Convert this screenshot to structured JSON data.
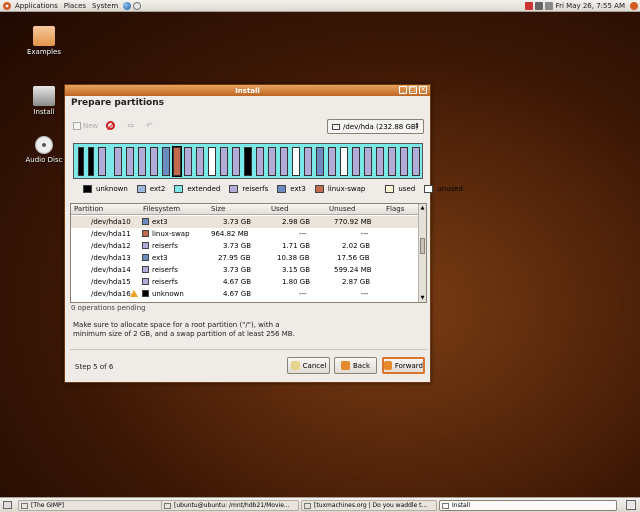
{
  "topbar": {
    "menus": [
      "Applications",
      "Places",
      "System"
    ],
    "clock": "Fri May 26,  7:55 AM"
  },
  "desktop": {
    "icons": [
      {
        "label": "Examples",
        "icon": "folder-icon"
      },
      {
        "label": "Install",
        "icon": "install-icon"
      },
      {
        "label": "Audio Disc",
        "icon": "cd-icon"
      }
    ]
  },
  "window": {
    "title": "Install",
    "heading": "Prepare partitions",
    "toolbar": {
      "new_label": "New"
    },
    "device": "/dev/hda  (232.88 GB)",
    "legend": [
      {
        "label": "unknown",
        "color": "#000000"
      },
      {
        "label": "ext2",
        "color": "#9fb7d8"
      },
      {
        "label": "extended",
        "color": "#7de8e8"
      },
      {
        "label": "reiserfs",
        "color": "#b3acd8"
      },
      {
        "label": "ext3",
        "color": "#6c8cc0"
      },
      {
        "label": "linux-swap",
        "color": "#c26a4f"
      },
      {
        "label": "used",
        "color": "#f6f2d2"
      },
      {
        "label": "unused",
        "color": "#ffffff"
      }
    ],
    "table": {
      "headers": [
        "Partition",
        "Filesystem",
        "Size",
        "Used",
        "Unused",
        "Flags"
      ],
      "rows": [
        {
          "partition": "/dev/hda10",
          "fs": "ext3",
          "size": "3.73 GB",
          "used": "2.98 GB",
          "unused": "770.92 MB",
          "color": "#6c8cc0"
        },
        {
          "partition": "/dev/hda11",
          "fs": "linux-swap",
          "size": "964.82 MB",
          "used": "---",
          "unused": "---",
          "color": "#c26a4f"
        },
        {
          "partition": "/dev/hda12",
          "fs": "reiserfs",
          "size": "3.73 GB",
          "used": "1.71 GB",
          "unused": "2.02 GB",
          "color": "#b3acd8"
        },
        {
          "partition": "/dev/hda13",
          "fs": "ext3",
          "size": "27.95 GB",
          "used": "10.38 GB",
          "unused": "17.56 GB",
          "color": "#6c8cc0"
        },
        {
          "partition": "/dev/hda14",
          "fs": "reiserfs",
          "size": "3.73 GB",
          "used": "3.15 GB",
          "unused": "599.24 MB",
          "color": "#b3acd8"
        },
        {
          "partition": "/dev/hda15",
          "fs": "reiserfs",
          "size": "4.67 GB",
          "used": "1.80 GB",
          "unused": "2.87 GB",
          "color": "#b3acd8"
        },
        {
          "partition": "/dev/hda16",
          "fs": "unknown",
          "size": "4.67 GB",
          "used": "---",
          "unused": "---",
          "color": "#000000",
          "warning": true
        }
      ]
    },
    "ops_pending": "0 operations pending",
    "hint_line1": "Make sure to allocate space for a root partition (\"/\"), with a",
    "hint_line2": "minimum size of 2 GB, and a swap partition of at least 256 MB.",
    "step": "Step 5 of 6",
    "buttons": {
      "cancel": "Cancel",
      "back": "Back",
      "forward": "Forward"
    }
  },
  "taskbar": {
    "items": [
      "[The GIMP]",
      "[ubuntu@ubuntu: /mnt/hdb21/Movie...",
      "[tuxmachines.org | Do you waddle t...",
      "Install"
    ]
  }
}
